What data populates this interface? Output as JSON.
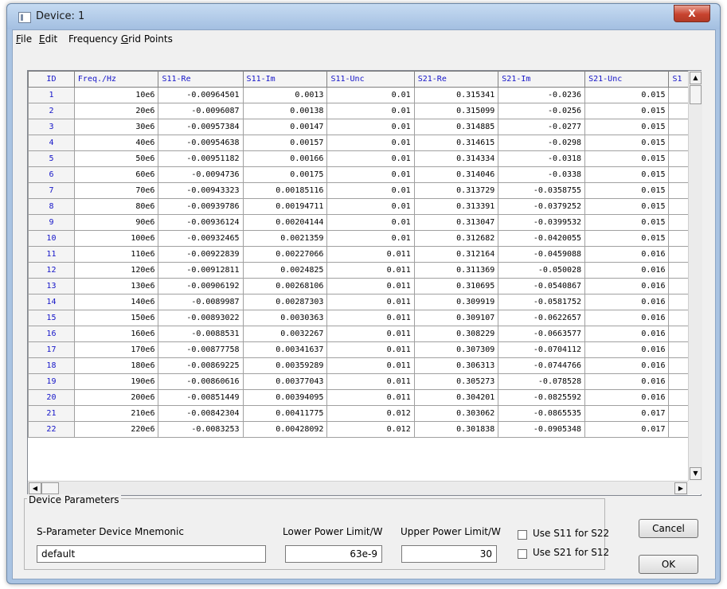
{
  "window": {
    "title": "Device: 1",
    "close_glyph": "X"
  },
  "menu": {
    "items": [
      {
        "label": "File",
        "accel": "F",
        "rest": "ile"
      },
      {
        "label": "Edit",
        "accel": "E",
        "rest": "dit"
      },
      {
        "label": "Frequency Grid Points",
        "pre": "Frequency ",
        "accel": "G",
        "rest": "rid Points"
      }
    ]
  },
  "table": {
    "columns": [
      "ID",
      "Freq./Hz",
      "S11-Re",
      "S11-Im",
      "S11-Unc",
      "S21-Re",
      "S21-Im",
      "S21-Unc",
      "S1"
    ],
    "rows": [
      [
        "1",
        "10e6",
        "-0.00964501",
        "0.0013",
        "0.01",
        "0.315341",
        "-0.0236",
        "0.015"
      ],
      [
        "2",
        "20e6",
        "-0.0096087",
        "0.00138",
        "0.01",
        "0.315099",
        "-0.0256",
        "0.015"
      ],
      [
        "3",
        "30e6",
        "-0.00957384",
        "0.00147",
        "0.01",
        "0.314885",
        "-0.0277",
        "0.015"
      ],
      [
        "4",
        "40e6",
        "-0.00954638",
        "0.00157",
        "0.01",
        "0.314615",
        "-0.0298",
        "0.015"
      ],
      [
        "5",
        "50e6",
        "-0.00951182",
        "0.00166",
        "0.01",
        "0.314334",
        "-0.0318",
        "0.015"
      ],
      [
        "6",
        "60e6",
        "-0.0094736",
        "0.00175",
        "0.01",
        "0.314046",
        "-0.0338",
        "0.015"
      ],
      [
        "7",
        "70e6",
        "-0.00943323",
        "0.00185116",
        "0.01",
        "0.313729",
        "-0.0358755",
        "0.015"
      ],
      [
        "8",
        "80e6",
        "-0.00939786",
        "0.00194711",
        "0.01",
        "0.313391",
        "-0.0379252",
        "0.015"
      ],
      [
        "9",
        "90e6",
        "-0.00936124",
        "0.00204144",
        "0.01",
        "0.313047",
        "-0.0399532",
        "0.015"
      ],
      [
        "10",
        "100e6",
        "-0.00932465",
        "0.0021359",
        "0.01",
        "0.312682",
        "-0.0420055",
        "0.015"
      ],
      [
        "11",
        "110e6",
        "-0.00922839",
        "0.00227066",
        "0.011",
        "0.312164",
        "-0.0459088",
        "0.016"
      ],
      [
        "12",
        "120e6",
        "-0.00912811",
        "0.0024825",
        "0.011",
        "0.311369",
        "-0.050028",
        "0.016"
      ],
      [
        "13",
        "130e6",
        "-0.00906192",
        "0.00268106",
        "0.011",
        "0.310695",
        "-0.0540867",
        "0.016"
      ],
      [
        "14",
        "140e6",
        "-0.0089987",
        "0.00287303",
        "0.011",
        "0.309919",
        "-0.0581752",
        "0.016"
      ],
      [
        "15",
        "150e6",
        "-0.00893022",
        "0.0030363",
        "0.011",
        "0.309107",
        "-0.0622657",
        "0.016"
      ],
      [
        "16",
        "160e6",
        "-0.0088531",
        "0.0032267",
        "0.011",
        "0.308229",
        "-0.0663577",
        "0.016"
      ],
      [
        "17",
        "170e6",
        "-0.00877758",
        "0.00341637",
        "0.011",
        "0.307309",
        "-0.0704112",
        "0.016"
      ],
      [
        "18",
        "180e6",
        "-0.00869225",
        "0.00359289",
        "0.011",
        "0.306313",
        "-0.0744766",
        "0.016"
      ],
      [
        "19",
        "190e6",
        "-0.00860616",
        "0.00377043",
        "0.011",
        "0.305273",
        "-0.078528",
        "0.016"
      ],
      [
        "20",
        "200e6",
        "-0.00851449",
        "0.00394095",
        "0.011",
        "0.304201",
        "-0.0825592",
        "0.016"
      ],
      [
        "21",
        "210e6",
        "-0.00842304",
        "0.00411775",
        "0.012",
        "0.303062",
        "-0.0865535",
        "0.017"
      ],
      [
        "22",
        "220e6",
        "-0.0083253",
        "0.00428092",
        "0.012",
        "0.301838",
        "-0.0905348",
        "0.017"
      ]
    ]
  },
  "params": {
    "legend": "Device Parameters",
    "mnemonic_label": "S-Parameter Device Mnemonic",
    "mnemonic_value": "default",
    "lower_label": "Lower Power Limit/W",
    "lower_value": "63e-9",
    "upper_label": "Upper Power Limit/W",
    "upper_value": "30",
    "use_s11_label": "Use S11 for S22",
    "use_s21_label": "Use S21 for S12"
  },
  "buttons": {
    "cancel": "Cancel",
    "ok": "OK"
  },
  "icons": {
    "scroll_up": "up-arrow-icon",
    "scroll_down": "down-arrow-icon",
    "scroll_left": "left-arrow-icon",
    "scroll_right": "right-arrow-icon",
    "app": "window-app-icon"
  }
}
